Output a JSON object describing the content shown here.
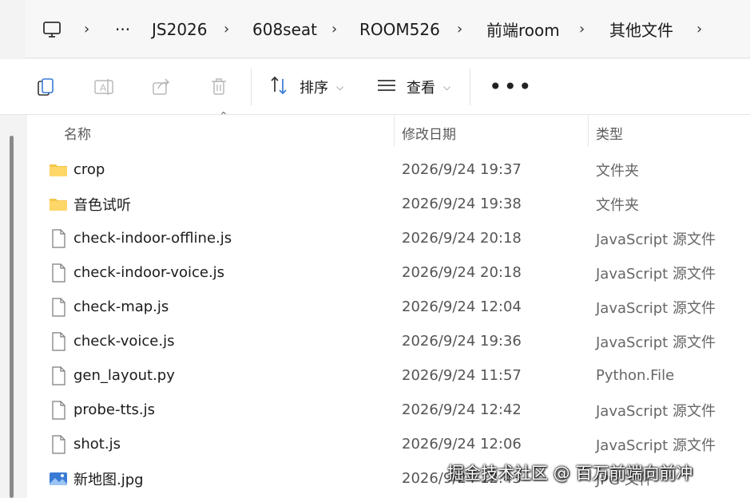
{
  "breadcrumb": {
    "icon": "computer-icon",
    "overflow": "···",
    "items": [
      "JS2026",
      "608seat",
      "ROOM526",
      "前端room",
      "其他文件"
    ]
  },
  "toolbar": {
    "sort_label": "排序",
    "view_label": "查看",
    "more_label": "•••",
    "icons": [
      "copy-icon",
      "rename-icon",
      "share-icon",
      "delete-icon",
      "sort-icon",
      "view-icon"
    ]
  },
  "columns": {
    "name": "名称",
    "date": "修改日期",
    "type": "类型"
  },
  "files": [
    {
      "name": "crop",
      "date": "2026/9/24 19:37",
      "type": "文件夹",
      "icon": "folder-icon"
    },
    {
      "name": "音色试听",
      "date": "2026/9/24 19:38",
      "type": "文件夹",
      "icon": "folder-icon"
    },
    {
      "name": "check-indoor-offline.js",
      "date": "2026/9/24 20:18",
      "type": "JavaScript 源文件",
      "icon": "file-icon"
    },
    {
      "name": "check-indoor-voice.js",
      "date": "2026/9/24 20:18",
      "type": "JavaScript 源文件",
      "icon": "file-icon"
    },
    {
      "name": "check-map.js",
      "date": "2026/9/24 12:04",
      "type": "JavaScript 源文件",
      "icon": "file-icon"
    },
    {
      "name": "check-voice.js",
      "date": "2026/9/24 19:36",
      "type": "JavaScript 源文件",
      "icon": "file-icon"
    },
    {
      "name": "gen_layout.py",
      "date": "2026/9/24 11:57",
      "type": "Python.File",
      "icon": "file-icon"
    },
    {
      "name": "probe-tts.js",
      "date": "2026/9/24 12:42",
      "type": "JavaScript 源文件",
      "icon": "file-icon"
    },
    {
      "name": "shot.js",
      "date": "2026/9/24 12:06",
      "type": "JavaScript 源文件",
      "icon": "file-icon"
    },
    {
      "name": "新地图.jpg",
      "date": "2026/9/24 12:43",
      "type": "JPG 文件",
      "icon": "image-icon"
    }
  ],
  "watermark": "掘金技术社区 @ 百万前端向前冲",
  "colors": {
    "folder": "#f4c64b",
    "accent": "#3a7bd5",
    "background": "#f3f3f3"
  }
}
